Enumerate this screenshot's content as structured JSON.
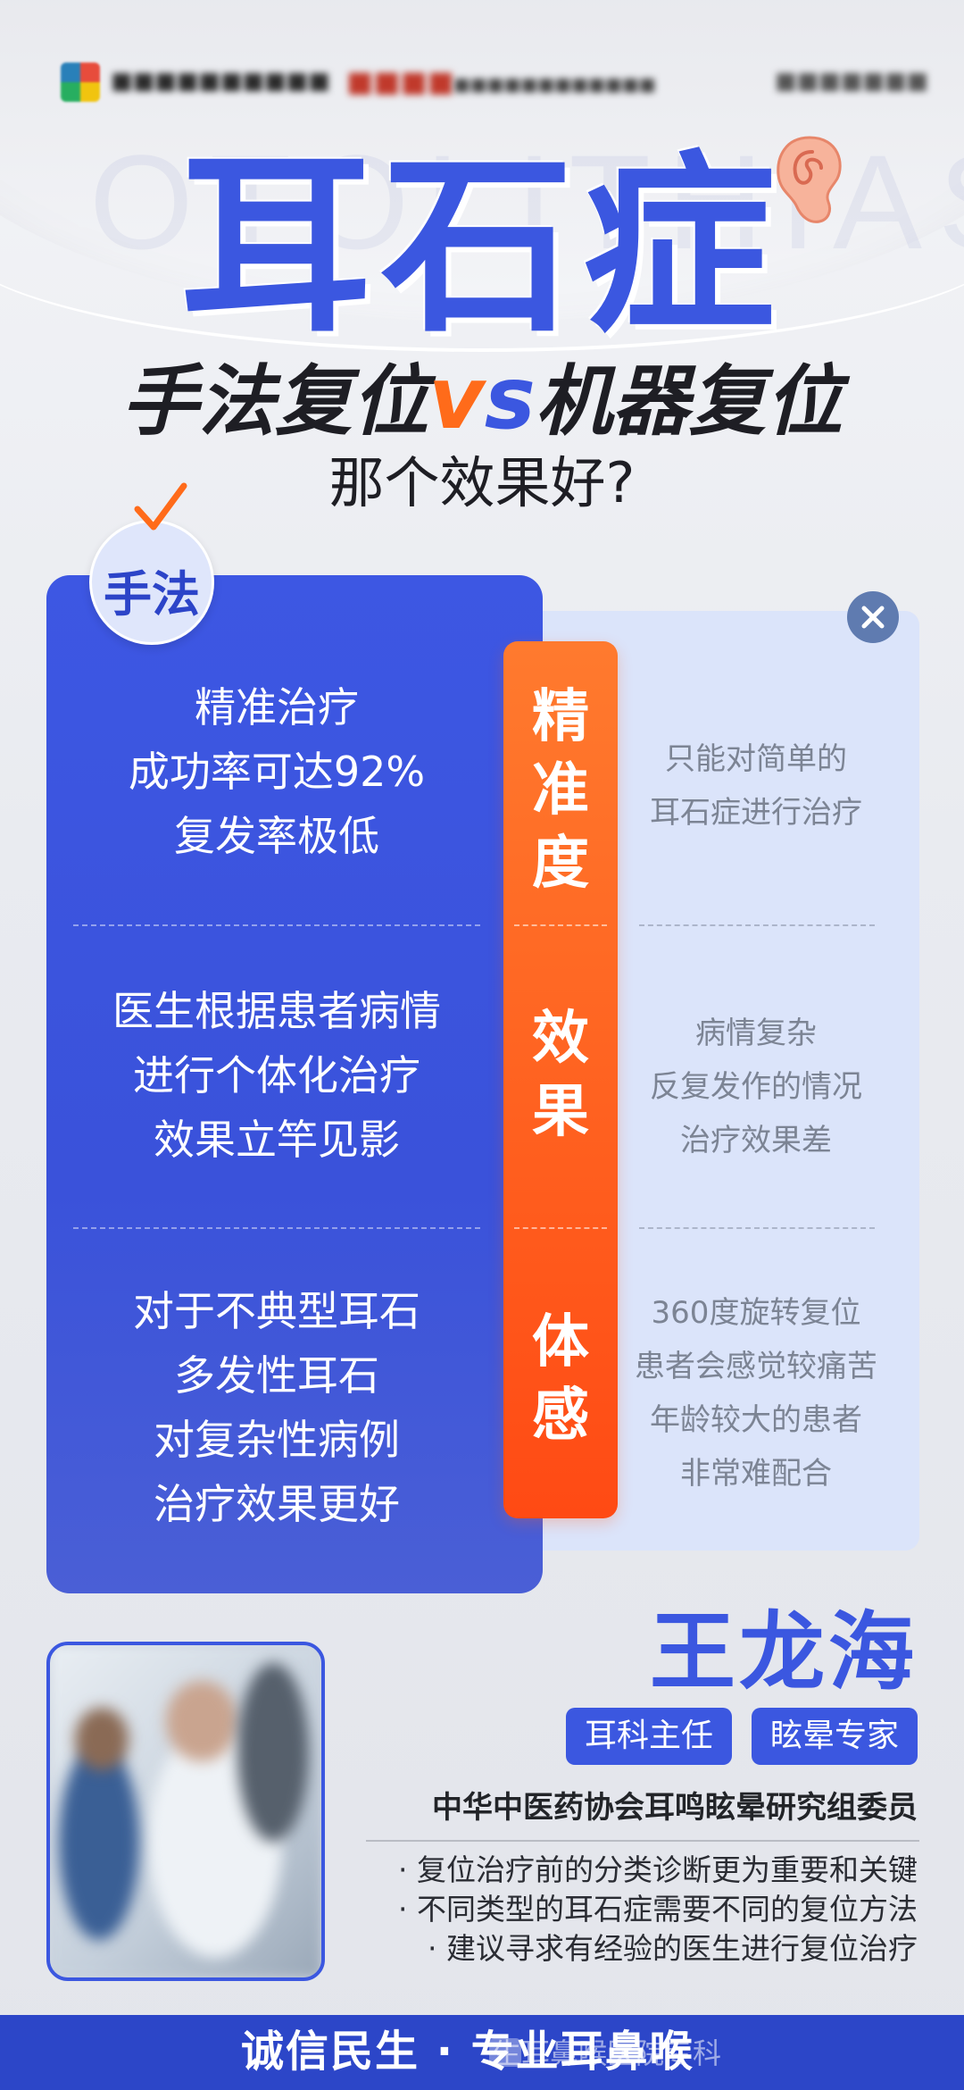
{
  "header": {
    "watermark_text": "OTOLITHIASIS",
    "title": "耳石症",
    "subtitle_left": "手法复位",
    "subtitle_vs": "v",
    "subtitle_vs2": "s",
    "subtitle_right": "机器复位",
    "question": "那个效果好?"
  },
  "left_column": {
    "tag": "手法",
    "blocks": [
      [
        "精准治疗",
        "成功率可达92%",
        "复发率极低"
      ],
      [
        "医生根据患者病情",
        "进行个体化治疗",
        "效果立竿见影"
      ],
      [
        "对于不典型耳石",
        "多发性耳石",
        "对复杂性病例",
        "治疗效果更好"
      ]
    ]
  },
  "center_column": {
    "labels": [
      [
        "精",
        "准",
        "度"
      ],
      [
        "效",
        "果"
      ],
      [
        "体",
        "感"
      ]
    ]
  },
  "right_column": {
    "blocks": [
      [
        "只能对简单的",
        "耳石症进行治疗"
      ],
      [
        "病情复杂",
        "反复发作的情况",
        "治疗效果差"
      ],
      [
        "360度旋转复位",
        "患者会感觉较痛苦",
        "年龄较大的患者",
        "非常难配合"
      ]
    ]
  },
  "doctor": {
    "name": "王龙海",
    "badges": [
      "耳科主任",
      "眩晕专家"
    ],
    "organization": "中华中医药协会耳鸣眩晕研究组委员",
    "bullets": [
      "· 复位治疗前的分类诊断更为重要和关键",
      "· 不同类型的耳石症需要不同的复位方法",
      "· 建议寻求有经验的医生进行复位治疗"
    ]
  },
  "footer": {
    "slogan": "诚信民生 · 专业耳鼻喉",
    "watermark": "生耳鼻喉医院专科"
  },
  "colors": {
    "primary_blue": "#3b57e0",
    "orange": "#ff5e1e",
    "light_blue_card": "#dbe4fa",
    "footer_blue": "#2c46c8"
  },
  "icons": [
    "ear-icon",
    "check-icon",
    "close-icon",
    "wechat-icon"
  ]
}
